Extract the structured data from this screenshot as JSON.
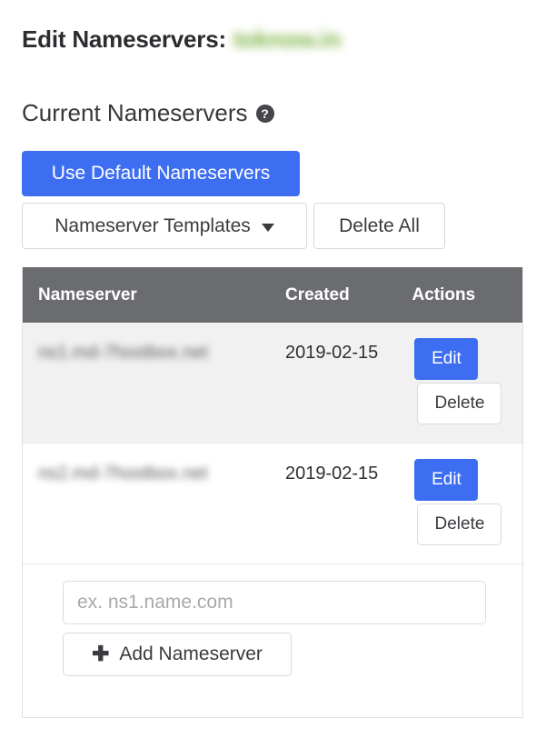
{
  "page": {
    "title_label": "Edit Nameservers:",
    "domain": "toknow.in",
    "domain_color": "#7cb342",
    "section_heading": "Current Nameservers",
    "help_icon": "question-mark-circle-icon"
  },
  "toolbar": {
    "use_default_label": "Use Default Nameservers",
    "templates_label": "Nameserver Templates",
    "templates_caret": "chevron-down-icon",
    "delete_all_label": "Delete All",
    "primary_color": "#3d6ef2"
  },
  "table": {
    "columns": [
      "Nameserver",
      "Created",
      "Actions"
    ],
    "rows": [
      {
        "nameserver": "ns1.md-7hostbox.net",
        "created": "2019-02-15",
        "edit_label": "Edit",
        "delete_label": "Delete"
      },
      {
        "nameserver": "ns2.md-7hostbox.net",
        "created": "2019-02-15",
        "edit_label": "Edit",
        "delete_label": "Delete"
      }
    ]
  },
  "add_form": {
    "input_value": "",
    "input_placeholder": "ex. ns1.name.com",
    "add_label": "Add Nameserver",
    "add_icon": "plus-icon"
  }
}
